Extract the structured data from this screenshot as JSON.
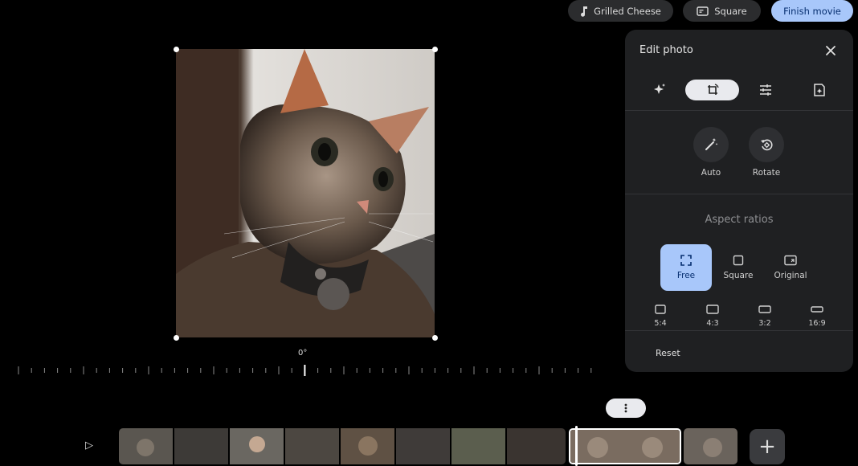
{
  "topbar": {
    "music_label": "Grilled Cheese",
    "format_label": "Square",
    "finish_label": "Finish movie"
  },
  "canvas": {
    "rotation_label": "0°"
  },
  "panel": {
    "title": "Edit photo",
    "tools": [
      "magic-icon",
      "crop-rotate-icon",
      "adjust-icon",
      "filter-icon"
    ],
    "active_tool": "crop-rotate-icon",
    "auto_label": "Auto",
    "rotate_label": "Rotate",
    "aspect_header": "Aspect ratios",
    "aspect_main": [
      {
        "label": "Free",
        "icon": "free-crop-icon",
        "active": true
      },
      {
        "label": "Square",
        "icon": "square-crop-icon",
        "active": false
      },
      {
        "label": "Original",
        "icon": "original-crop-icon",
        "active": false
      }
    ],
    "aspect_small": [
      {
        "label": "5:4",
        "icon": "ratio-5-4-icon"
      },
      {
        "label": "4:3",
        "icon": "ratio-4-3-icon"
      },
      {
        "label": "3:2",
        "icon": "ratio-3-2-icon"
      },
      {
        "label": "16:9",
        "icon": "ratio-16-9-icon"
      }
    ],
    "reset_label": "Reset"
  },
  "timeline": {
    "play_icon": "play-icon",
    "add_icon": "plus-icon",
    "more_icon": "more-vert-icon",
    "clips": [
      "clip-cat-1",
      "clip-cat-2",
      "clip-person",
      "clip-cat-3",
      "clip-cat-4",
      "clip-cat-5",
      "clip-grass",
      "clip-cat-6",
      "clip-selected",
      "clip-cat-7"
    ]
  },
  "colors": {
    "accent": "#a8c7fa",
    "accent_text": "#062e6f",
    "panel_bg": "#1f2022",
    "pill_bg": "#2b2c2e"
  }
}
